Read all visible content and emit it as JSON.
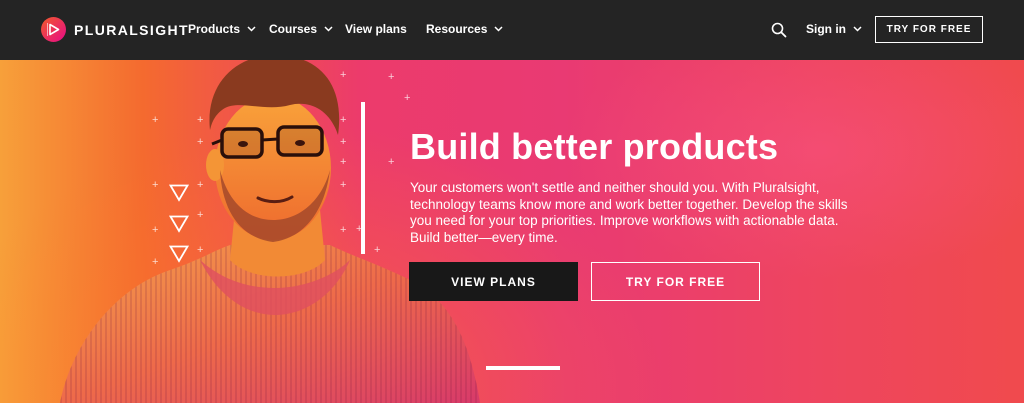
{
  "brand": {
    "name": "PLURALSIGHT",
    "logo_color": "#f15b2a",
    "logo_accent": "#e80a89"
  },
  "nav": {
    "items": [
      {
        "label": "Products",
        "has_dropdown": true
      },
      {
        "label": "Courses",
        "has_dropdown": true
      },
      {
        "label": "View plans",
        "has_dropdown": false
      },
      {
        "label": "Resources",
        "has_dropdown": true
      }
    ],
    "search_icon": "search-icon",
    "sign_in": {
      "label": "Sign in",
      "has_dropdown": true
    },
    "cta": "TRY FOR FREE"
  },
  "hero": {
    "headline": "Build better products",
    "body": "Your customers won't settle and neither should you. With Pluralsight, technology teams know more and work better together. Develop the skills you need for your top priorities. Improve workflows with actionable data. Build better—every time.",
    "primary_button": "VIEW PLANS",
    "secondary_button": "TRY FOR FREE",
    "colors": {
      "orange": "#f7a03a",
      "pink": "#ec3b6b",
      "red": "#f04a4d"
    }
  }
}
